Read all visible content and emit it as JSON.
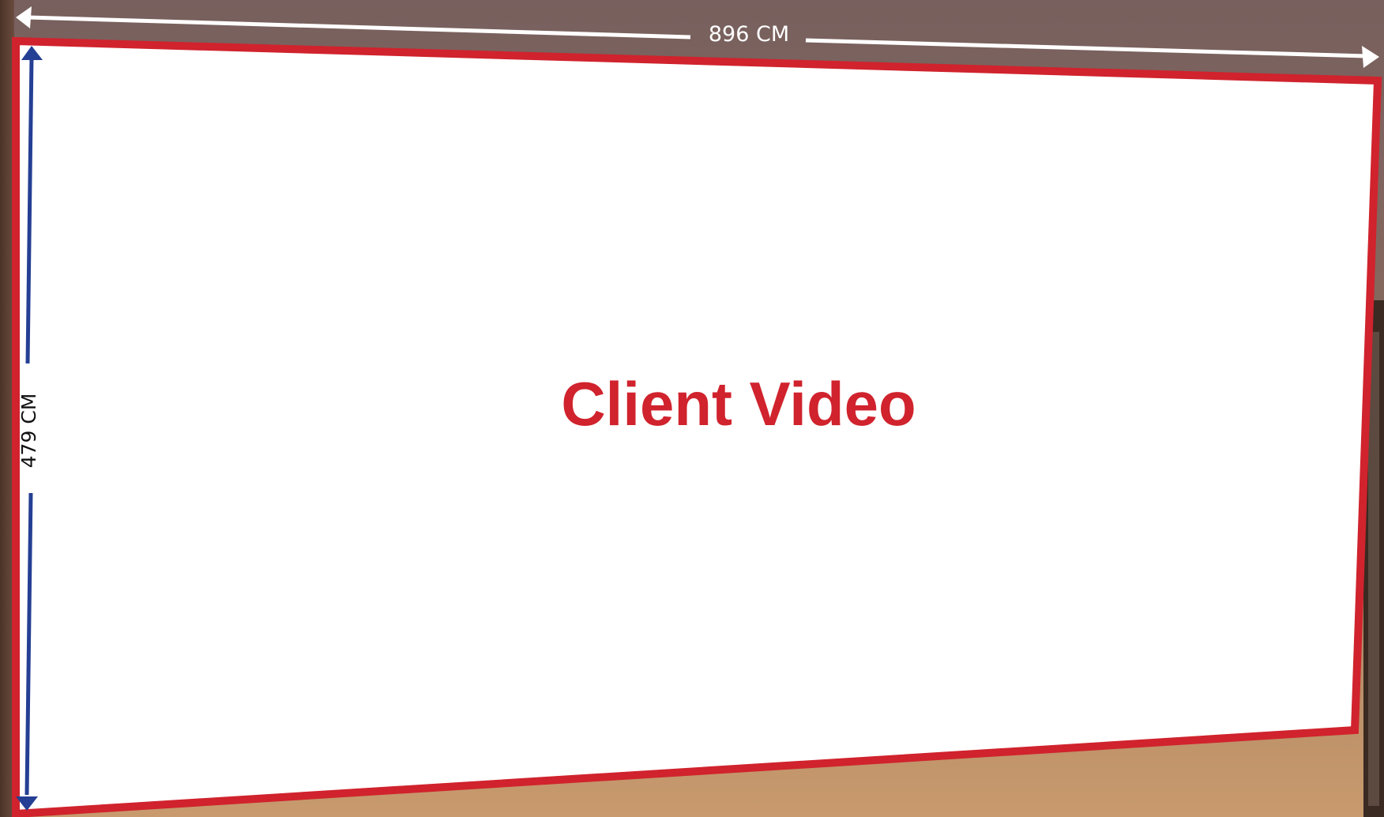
{
  "screen": {
    "title": "Client Video",
    "width_label": "896 CM",
    "height_label": "479 CM"
  },
  "colors": {
    "screen_border": "#d0232d",
    "title_text": "#d0232d",
    "width_arrow": "#ffffff",
    "width_label_text": "#ffffff",
    "height_arrow": "#243f93",
    "height_label_text": "#111111",
    "wall_top": "#77605d",
    "wall_bottom": "#c89a6d"
  }
}
